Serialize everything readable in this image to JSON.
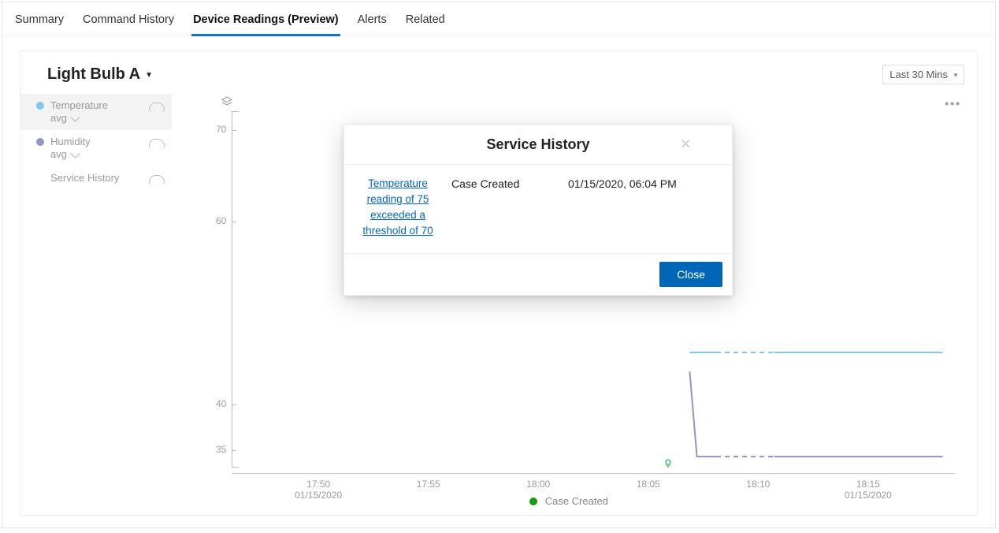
{
  "tabs": [
    "Summary",
    "Command History",
    "Device Readings (Preview)",
    "Alerts",
    "Related"
  ],
  "active_tab_index": 2,
  "card": {
    "title": "Light Bulb A",
    "range_label": "Last 30 Mins"
  },
  "legend": {
    "items": [
      {
        "label": "Temperature",
        "sub": "avg",
        "color": "#7fc7f0",
        "has_sub": true
      },
      {
        "label": "Humidity",
        "sub": "avg",
        "color": "#8e95c7",
        "has_sub": true
      },
      {
        "label": "Service History",
        "sub": "",
        "color": "",
        "has_sub": false
      }
    ],
    "active_index": 0
  },
  "chart_data": {
    "type": "line",
    "title": "",
    "xlabel": "",
    "ylabel": "",
    "ylim": [
      33,
      72
    ],
    "y_ticks": [
      70,
      60,
      40,
      35
    ],
    "x_ticks": [
      {
        "major": "17:50",
        "minor": "01/15/2020"
      },
      {
        "major": "17:55",
        "minor": ""
      },
      {
        "major": "18:00",
        "minor": ""
      },
      {
        "major": "18:05",
        "minor": ""
      },
      {
        "major": "18:10",
        "minor": ""
      },
      {
        "major": "18:15",
        "minor": "01/15/2020"
      }
    ],
    "x_range_minutes": [
      47.5,
      17.5
    ],
    "series": [
      {
        "name": "Temperature",
        "color": "#7fc7f0",
        "segments": [
          {
            "style": "solid",
            "points": [
              [
                6.5,
                45.6
              ],
              [
                7.6,
                45.6
              ]
            ]
          },
          {
            "style": "dashed",
            "points": [
              [
                7.6,
                45.6
              ],
              [
                10.0,
                45.6
              ]
            ]
          },
          {
            "style": "solid",
            "points": [
              [
                10.0,
                45.6
              ],
              [
                17.0,
                45.6
              ]
            ]
          }
        ]
      },
      {
        "name": "Humidity",
        "color": "#8e95c7",
        "segments": [
          {
            "style": "solid",
            "points": [
              [
                6.5,
                43.5
              ],
              [
                6.8,
                34.2
              ],
              [
                7.6,
                34.2
              ]
            ]
          },
          {
            "style": "dashed",
            "points": [
              [
                7.6,
                34.2
              ],
              [
                10.0,
                34.2
              ]
            ]
          },
          {
            "style": "solid",
            "points": [
              [
                10.0,
                34.2
              ],
              [
                17.0,
                34.2
              ]
            ]
          }
        ]
      }
    ],
    "markers": [
      {
        "x_minute": 5.6,
        "label": "Case Created",
        "color": "#79d3a2"
      }
    ]
  },
  "bottom_legend": {
    "label": "Case Created",
    "color": "#12a10a"
  },
  "modal": {
    "title": "Service History",
    "link_text": "Temperature reading of 75 exceeded a threshold of 70",
    "event_type": "Case Created",
    "timestamp": "01/15/2020, 06:04 PM",
    "close_label": "Close"
  }
}
